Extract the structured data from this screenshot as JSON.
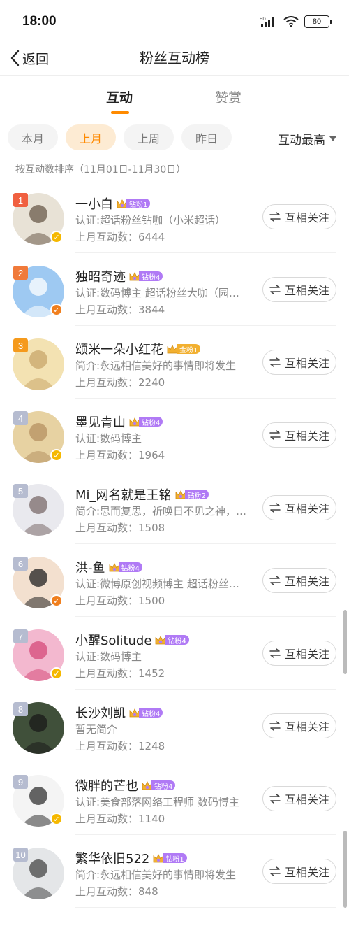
{
  "status_bar": {
    "time": "18:00",
    "battery": "80"
  },
  "nav": {
    "back_label": "返回",
    "title": "粉丝互动榜"
  },
  "tabs": [
    {
      "label": "互动"
    },
    {
      "label": "赞赏"
    }
  ],
  "filters": [
    {
      "label": "本月"
    },
    {
      "label": "上月"
    },
    {
      "label": "上周"
    },
    {
      "label": "昨日"
    }
  ],
  "sort": {
    "label": "互动最高"
  },
  "sort_description": "按互动数排序（11月01日-11月30日）",
  "colors": {
    "accent": "#ff8a00",
    "rank_1": "#f06040",
    "rank_2": "#f07a3a",
    "rank_3": "#f59a1c",
    "rank_other": "#b6bcd0",
    "badge_diamond": "#b07af5",
    "badge_gold": "#f2b030",
    "verify_yellow": "#f5b800",
    "verify_orange": "#f07f1e"
  },
  "follow_button_label": "互相关注",
  "follow_icon": "swap-arrows-icon",
  "users": [
    {
      "rank": "1",
      "name": "一小白",
      "badge": "钻粉1",
      "badge_type": "diamond",
      "desc": "认证:超话粉丝钻咖（小米超话）",
      "count": "上月互动数：6444",
      "verify": "yellow",
      "avatar_colors": [
        "#e8e2d6",
        "#6a5a4a"
      ]
    },
    {
      "rank": "2",
      "name": "独昭奇迹",
      "badge": "钻粉4",
      "badge_type": "diamond",
      "desc": "认证:数码博主 超话粉丝大咖（园…",
      "count": "上月互动数：3844",
      "verify": "orange",
      "avatar_colors": [
        "#9ec9f2",
        "#ffffff"
      ]
    },
    {
      "rank": "3",
      "name": "颂米一朵小红花",
      "badge": "金粉1",
      "badge_type": "gold",
      "desc": "简介:永远相信美好的事情即将发生",
      "count": "上月互动数：2240",
      "verify": "none",
      "avatar_colors": [
        "#f3e2b2",
        "#c8a66a"
      ]
    },
    {
      "rank": "4",
      "name": "墨见青山",
      "badge": "钻粉4",
      "badge_type": "diamond",
      "desc": "认证:数码博主",
      "count": "上月互动数：1964",
      "verify": "yellow",
      "avatar_colors": [
        "#e7d2a2",
        "#b59060"
      ]
    },
    {
      "rank": "5",
      "name": "Mi_网名就是王铭",
      "badge": "钻粉2",
      "badge_type": "diamond",
      "desc": "简介:思而复思，祈唤日不见之神，…",
      "count": "上月互动数：1508",
      "verify": "none",
      "avatar_colors": [
        "#e9e9ee",
        "#7a6a6a"
      ]
    },
    {
      "rank": "6",
      "name": "洪-鱼",
      "badge": "钻粉4",
      "badge_type": "diamond",
      "desc": "认证:微博原创视频博主 超话粉丝…",
      "count": "上月互动数：1500",
      "verify": "orange",
      "avatar_colors": [
        "#f3e0cf",
        "#202020"
      ]
    },
    {
      "rank": "7",
      "name": "小醒Solitude",
      "badge": "钻粉4",
      "badge_type": "diamond",
      "desc": "认证:数码博主",
      "count": "上月互动数：1452",
      "verify": "yellow",
      "avatar_colors": [
        "#f3b8cf",
        "#d64a7a"
      ]
    },
    {
      "rank": "8",
      "name": "长沙刘凯",
      "badge": "钻粉4",
      "badge_type": "diamond",
      "desc": "暂无简介",
      "count": "上月互动数：1248",
      "verify": "none",
      "avatar_colors": [
        "#40503a",
        "#1a1a1a"
      ]
    },
    {
      "rank": "9",
      "name": "微胖的芒也",
      "badge": "钻粉4",
      "badge_type": "diamond",
      "desc": "认证:美食部落网络工程师 数码博主",
      "count": "上月互动数：1140",
      "verify": "yellow",
      "avatar_colors": [
        "#f4f4f4",
        "#333333"
      ]
    },
    {
      "rank": "10",
      "name": "繁华依旧522",
      "badge": "钻粉1",
      "badge_type": "diamond",
      "desc": "简介:永远相信美好的事情即将发生",
      "count": "上月互动数：848",
      "verify": "none",
      "avatar_colors": [
        "#e4e6e8",
        "#454545"
      ]
    }
  ]
}
